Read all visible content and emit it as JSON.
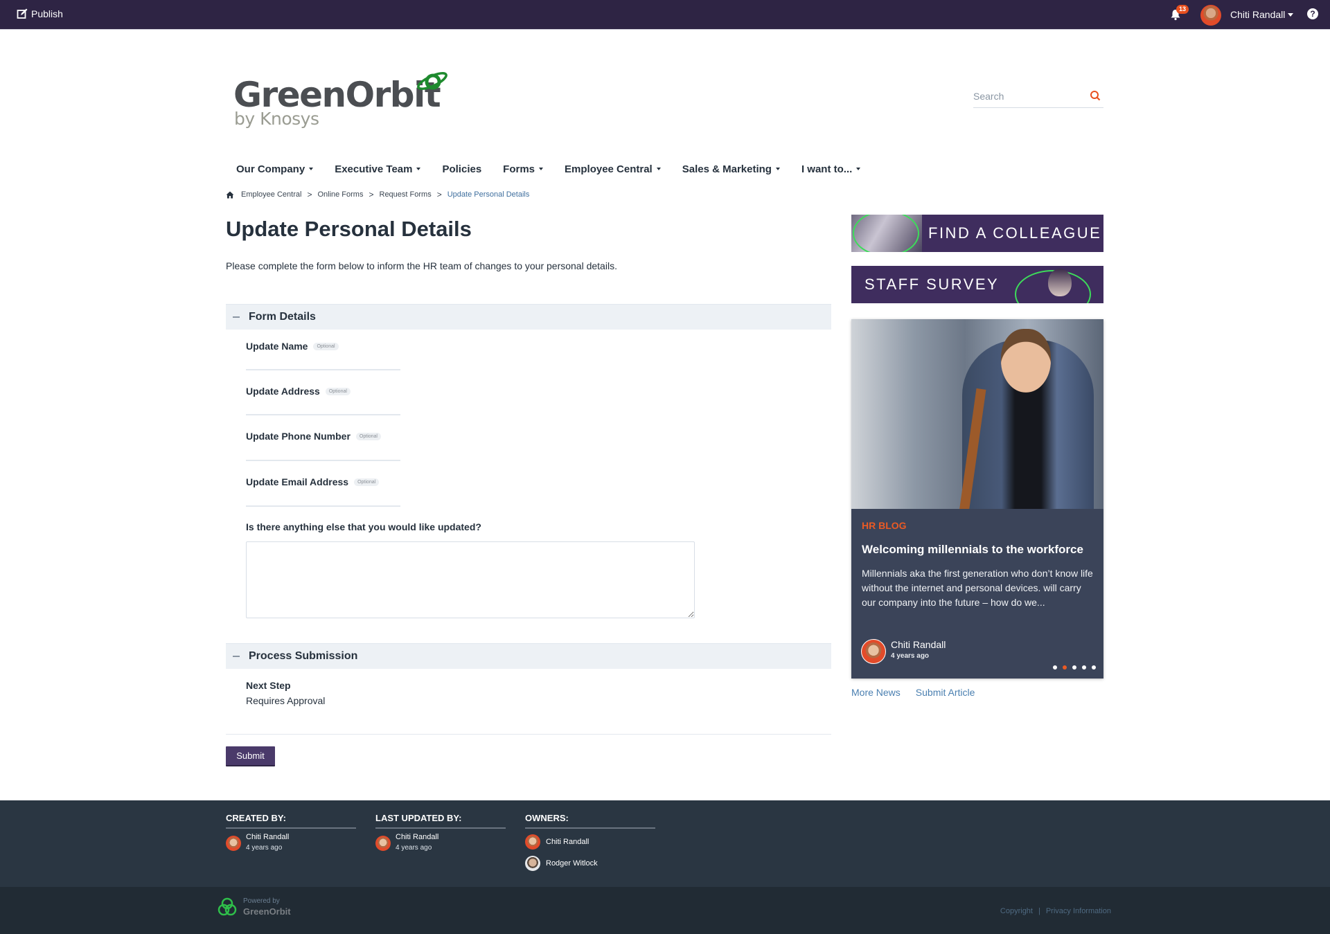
{
  "topbar": {
    "publish_label": "Publish",
    "notification_count": "13",
    "user_name": "Chiti Randall",
    "help_glyph": "?",
    "icons": {
      "publish": "edit-square-icon",
      "notifications": "bell-icon",
      "help": "question-circle-icon"
    }
  },
  "brand": {
    "logo_main": "GreenOrbit",
    "logo_sub": "by Knosys",
    "accent_green": "#1e8a2e"
  },
  "search": {
    "placeholder": "Search",
    "value": "",
    "icon": "search-icon",
    "icon_color": "#e8501f"
  },
  "nav": {
    "items": [
      {
        "label": "Our Company",
        "has_dropdown": true
      },
      {
        "label": "Executive Team",
        "has_dropdown": true
      },
      {
        "label": "Policies",
        "has_dropdown": false
      },
      {
        "label": "Forms",
        "has_dropdown": true
      },
      {
        "label": "Employee Central",
        "has_dropdown": true
      },
      {
        "label": "Sales & Marketing",
        "has_dropdown": true
      },
      {
        "label": "I want to...",
        "has_dropdown": true
      }
    ]
  },
  "breadcrumb": {
    "items": [
      "Employee Central",
      "Online Forms",
      "Request Forms"
    ],
    "current": "Update Personal Details",
    "separator": ">"
  },
  "page": {
    "title": "Update Personal Details",
    "intro": "Please complete the form below to inform the HR team of changes to your personal details."
  },
  "form": {
    "section_form_details": "Form Details",
    "optional_badge": "Optional",
    "fields": [
      {
        "label": "Update Name",
        "value": ""
      },
      {
        "label": "Update Address",
        "value": ""
      },
      {
        "label": "Update Phone Number",
        "value": ""
      },
      {
        "label": "Update Email Address",
        "value": ""
      }
    ],
    "textarea_label": "Is there anything else that you would like updated?",
    "textarea_value": "",
    "section_process": "Process Submission",
    "next_step_label": "Next Step",
    "next_step_value": "Requires Approval",
    "submit_label": "Submit",
    "submit_color": "#4a3a6a"
  },
  "sidebar": {
    "banner_colleague": "FIND A COLLEAGUE",
    "banner_survey": "STAFF SURVEY",
    "banner_color": "#3f2d5e",
    "news_card": {
      "category": "HR BLOG",
      "title": "Welcoming millennials to the workforce",
      "excerpt": "Millennials aka the first generation who don’t know life without the internet and personal devices. will carry our company into the future – how do we...",
      "author": "Chiti Randall",
      "time": "4 years ago",
      "carousel_total": 5,
      "carousel_active": 2,
      "category_color": "#ea5a24"
    },
    "links": {
      "more_news": "More News",
      "submit_article": "Submit Article"
    }
  },
  "meta": {
    "created_by": {
      "header": "CREATED BY:",
      "name": "Chiti Randall",
      "time": "4 years ago"
    },
    "last_updated_by": {
      "header": "LAST UPDATED BY:",
      "name": "Chiti Randall",
      "time": "4 years ago"
    },
    "owners": {
      "header": "OWNERS:",
      "names": [
        "Chiti Randall",
        "Rodger Witlock"
      ]
    }
  },
  "footer": {
    "powered_by": "Powered by",
    "brand": "GreenOrbit",
    "copyright": "Copyright",
    "separator": "|",
    "privacy": "Privacy Information"
  }
}
